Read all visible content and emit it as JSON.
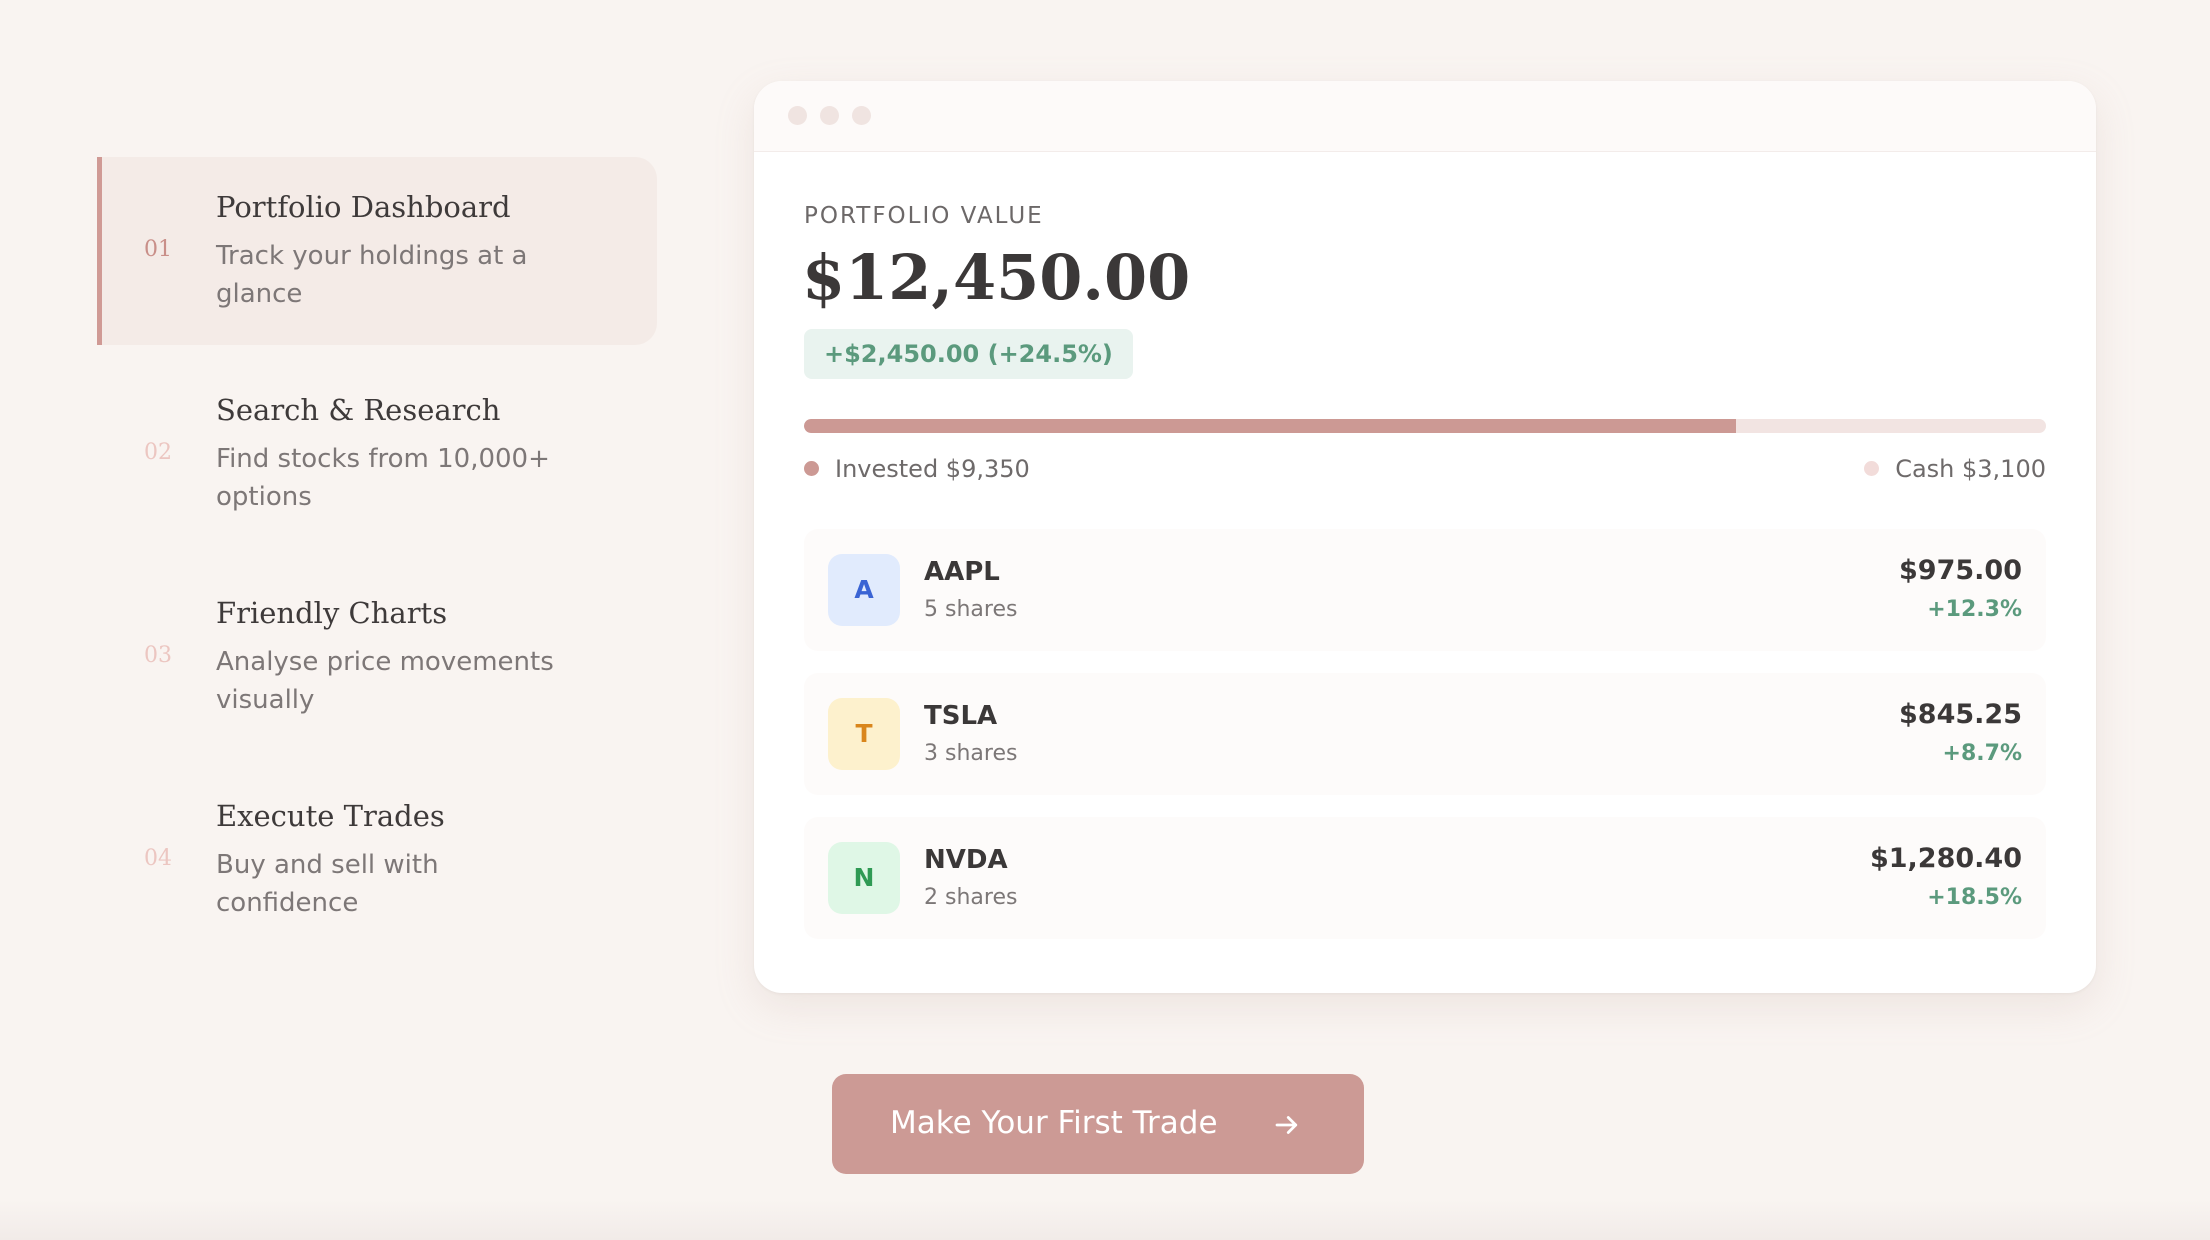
{
  "steps": [
    {
      "number": "01",
      "title": "Portfolio Dashboard",
      "description": "Track your holdings at a glance",
      "active": true
    },
    {
      "number": "02",
      "title": "Search & Research",
      "description": "Find stocks from 10,000+ options",
      "active": false
    },
    {
      "number": "03",
      "title": "Friendly Charts",
      "description": "Analyse price movements visually",
      "active": false
    },
    {
      "number": "04",
      "title": "Execute Trades",
      "description": "Buy and sell with confidence",
      "active": false
    }
  ],
  "portfolio": {
    "label": "PORTFOLIO VALUE",
    "value": "$12,450.00",
    "change": "+$2,450.00 (+24.5%)",
    "invested_fraction": 0.75,
    "invested_label": "Invested $9,350",
    "cash_label": "Cash $3,100"
  },
  "holdings": [
    {
      "avatar": "A",
      "ticker": "AAPL",
      "shares": "5 shares",
      "price": "$975.00",
      "change": "+12.3%"
    },
    {
      "avatar": "T",
      "ticker": "TSLA",
      "shares": "3 shares",
      "price": "$845.25",
      "change": "+8.7%"
    },
    {
      "avatar": "N",
      "ticker": "NVDA",
      "shares": "2 shares",
      "price": "$1,280.40",
      "change": "+18.5%"
    }
  ],
  "cta": {
    "label": "Make Your First Trade",
    "icon": "arrow-right-icon"
  },
  "colors": {
    "accent": "#cc9a95",
    "positive": "#5b9a7d",
    "background": "#f9f4f1",
    "avatar_aapl_bg": "#e1ebfd",
    "avatar_aapl_fg": "#3a64d4",
    "avatar_tsla_bg": "#fdf1cd",
    "avatar_tsla_fg": "#d9861c",
    "avatar_nvda_bg": "#dff7e6",
    "avatar_nvda_fg": "#2f9a54"
  }
}
